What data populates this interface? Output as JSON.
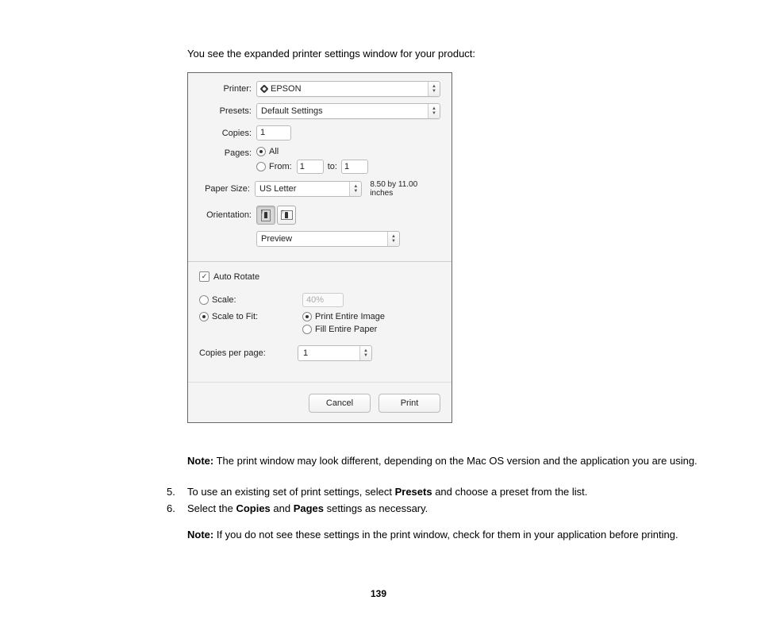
{
  "intro": "You see the expanded printer settings window for your product:",
  "dialog": {
    "labels": {
      "printer": "Printer:",
      "presets": "Presets:",
      "copies": "Copies:",
      "pages": "Pages:",
      "papersize": "Paper Size:",
      "orientation": "Orientation:"
    },
    "printer": "EPSON",
    "presets": "Default Settings",
    "copies": "1",
    "pages": {
      "all": "All",
      "from_lbl": "From:",
      "from": "1",
      "to_lbl": "to:",
      "to": "1"
    },
    "paper": {
      "value": "US Letter",
      "dim": "8.50 by 11.00 inches"
    },
    "preview": "Preview",
    "autorotate": "Auto Rotate",
    "scale_lbl": "Scale:",
    "scale_val": "40%",
    "fit_lbl": "Scale to Fit:",
    "print_entire": "Print Entire Image",
    "fill_entire": "Fill Entire Paper",
    "cpp_lbl": "Copies per page:",
    "cpp_val": "1",
    "cancel": "Cancel",
    "print": "Print"
  },
  "note1_label": "Note:",
  "note1_text": " The print window may look different, depending on the Mac OS version and the application you are using.",
  "steps": {
    "5": {
      "num": "5.",
      "a": "To use an existing set of print settings, select ",
      "b": "Presets",
      "c": " and choose a preset from the list."
    },
    "6": {
      "num": "6.",
      "a": "Select the ",
      "b": "Copies",
      "c": " and ",
      "d": "Pages",
      "e": " settings as necessary."
    }
  },
  "note2_label": "Note:",
  "note2_text": " If you do not see these settings in the print window, check for them in your application before printing.",
  "page_number": "139"
}
